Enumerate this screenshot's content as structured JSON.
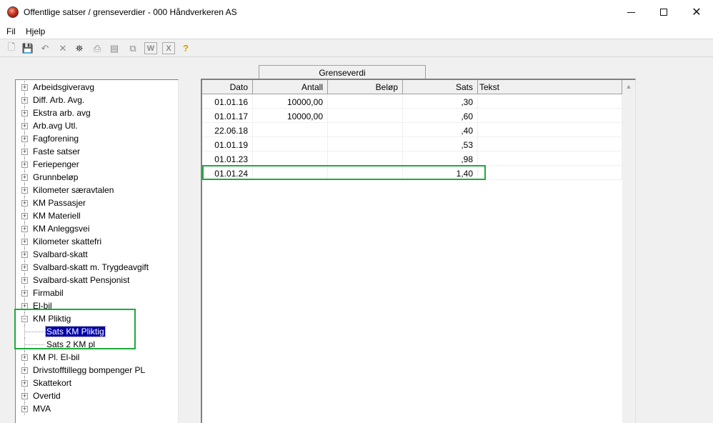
{
  "window": {
    "title": "Offentlige satser / grenseverdier - 000 Håndverkeren AS",
    "minimize_symbol": "",
    "maximize_symbol": "",
    "close_symbol": "✕"
  },
  "menu": {
    "file": "Fil",
    "help": "Hjelp"
  },
  "toolbar": {
    "icons": [
      "new-icon",
      "save-icon",
      "undo-icon",
      "delete-icon",
      "find-icon",
      "print-icon",
      "form-icon",
      "copy-icon",
      "word-icon",
      "excel-icon",
      "help-icon"
    ],
    "glyphs": {
      "new": "🗋",
      "save": "💾",
      "undo": "↶",
      "delete": "✕",
      "find": "⛯",
      "print": "⎙",
      "form": "▤",
      "copy": "⧉",
      "word": "W",
      "excel": "X",
      "help": "?"
    }
  },
  "tree": {
    "expand_glyph": "+",
    "collapse_glyph": "−",
    "items": [
      "Arbeidsgiveravg",
      "Diff. Arb. Avg.",
      "Ekstra arb. avg",
      "Arb.avg Utl.",
      "Fagforening",
      "Faste satser",
      "Feriepenger",
      "Grunnbeløp",
      "Kilometer særavtalen",
      "KM Passasjer",
      "KM Materiell",
      "KM Anleggsvei",
      "Kilometer skattefri",
      "Svalbard-skatt",
      "Svalbard-skatt m. Trygdeavgift",
      "Svalbard-skatt Pensjonist",
      "Firmabil",
      "El-bil",
      "KM Pliktig",
      "KM Pl. El-bil",
      "Drivstofftillegg bompenger PL",
      "Skattekort",
      "Overtid",
      "MVA"
    ],
    "expanded_item": "KM Pliktig",
    "children": [
      "Sats KM Pliktig",
      "Sats 2 KM pl"
    ],
    "selected_child": "Sats KM Pliktig"
  },
  "tab": {
    "label": "Grenseverdi"
  },
  "grid": {
    "columns": [
      "Dato",
      "Antall",
      "Beløp",
      "Sats",
      "Tekst"
    ],
    "rows": [
      [
        "01.01.16",
        "10000,00",
        "",
        ",30",
        ""
      ],
      [
        "01.01.17",
        "10000,00",
        "",
        ",60",
        ""
      ],
      [
        "22.06.18",
        "",
        "",
        ",40",
        ""
      ],
      [
        "01.01.19",
        "",
        "",
        ",53",
        ""
      ],
      [
        "01.01.23",
        "",
        "",
        ",98",
        ""
      ],
      [
        "01.01.24",
        "",
        "",
        "1,40",
        ""
      ]
    ],
    "scroll_up_glyph": "▲"
  },
  "colors": {
    "highlight": "#1faa3a",
    "selection": "#0000a8"
  }
}
